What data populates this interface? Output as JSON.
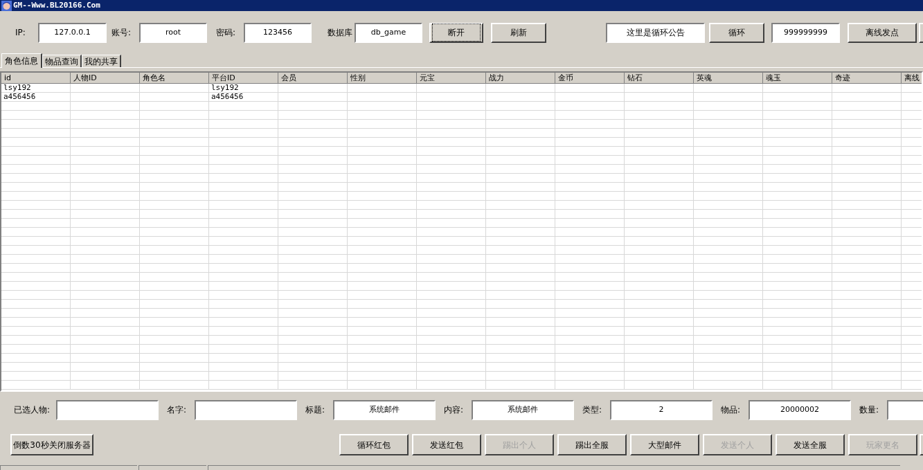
{
  "window": {
    "title": "GM--Www.BL20166.Com"
  },
  "connection_fields": [
    {
      "label": "IP:",
      "value": "127.0.0.1"
    },
    {
      "label": "账号:",
      "value": "root"
    },
    {
      "label": "密码:",
      "value": "123456"
    },
    {
      "label": "数据库",
      "value": "db_game"
    }
  ],
  "connection_buttons": [
    {
      "label": "断开",
      "focused": true
    },
    {
      "label": "刷新",
      "focused": false
    }
  ],
  "notice_field": {
    "value": "这里是循环公告"
  },
  "loop_button": {
    "label": "循环"
  },
  "loop_count_field": {
    "value": "999999999"
  },
  "offline_button": {
    "label": "离线发点"
  },
  "tabs": [
    {
      "label": "角色信息",
      "selected": true
    },
    {
      "label": "物品查询",
      "selected": false
    },
    {
      "label": "我的共享",
      "selected": false
    }
  ],
  "table": {
    "columns": [
      "id",
      "人物ID",
      "角色名",
      "平台ID",
      "会员",
      "性别",
      "元宝",
      "战力",
      "金币",
      "钻石",
      "英魂",
      "魂玉",
      "奇迹",
      "离线"
    ],
    "rows": [
      [
        "lsy192",
        "",
        "",
        "lsy192",
        "",
        "",
        "",
        "",
        "",
        "",
        "",
        "",
        "",
        ""
      ],
      [
        "a456456",
        "",
        "",
        "a456456",
        "",
        "",
        "",
        "",
        "",
        "",
        "",
        "",
        "",
        ""
      ]
    ]
  },
  "mail_fields": [
    {
      "label": "已选人物:"
    },
    {
      "label": "名字:"
    },
    {
      "label": "标题:",
      "value": "系统邮件"
    },
    {
      "label": "内容:",
      "value": "系统邮件"
    },
    {
      "label": "类型:",
      "value": "2"
    },
    {
      "label": "物品:",
      "value": "20000002"
    },
    {
      "label": "数量:"
    }
  ],
  "shutdown_button": {
    "label": "倒数30秒关闭服务器"
  },
  "action_buttons": [
    {
      "label": "循环红包",
      "disabled": false
    },
    {
      "label": "发送红包",
      "disabled": false
    },
    {
      "label": "踢出个人",
      "disabled": true
    },
    {
      "label": "踢出全服",
      "disabled": false
    },
    {
      "label": "大型邮件",
      "disabled": false
    },
    {
      "label": "发送个人",
      "disabled": true
    },
    {
      "label": "发送全服",
      "disabled": false
    },
    {
      "label": "玩家更名",
      "disabled": true
    }
  ]
}
